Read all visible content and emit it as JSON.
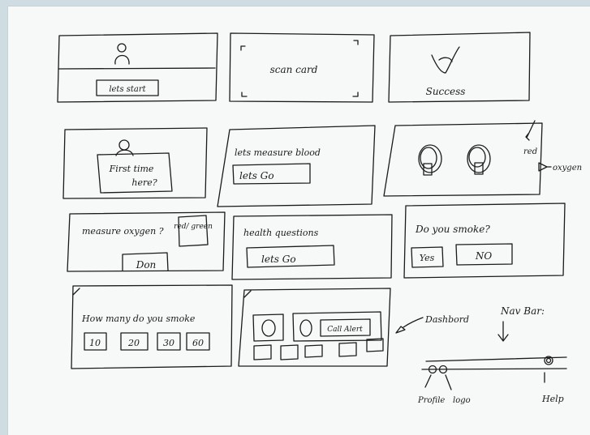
{
  "screens": {
    "s1": {
      "button": "lets start"
    },
    "s2": {
      "label": "scan card"
    },
    "s3": {
      "label": "Success"
    },
    "s4": {
      "line1": "First time",
      "line2": "here?"
    },
    "s5": {
      "title": "lets measure blood",
      "button": "lets Go"
    },
    "s6": {
      "side1": "red",
      "side2": "oxygen"
    },
    "s7": {
      "title": "measure oxygen ?",
      "chip": "red/ green",
      "button": "Don"
    },
    "s8": {
      "title": "health questions",
      "button": "lets Go"
    },
    "s9": {
      "title": "Do you smoke?",
      "yes": "Yes",
      "no": "NO"
    },
    "s10": {
      "title": "How many do you smoke",
      "options": [
        "10",
        "20",
        "30",
        "60"
      ]
    },
    "s11": {
      "button": "Call Alert"
    }
  },
  "annotations": {
    "dashboard": "Dashbord",
    "navbar": "Nav Bar:",
    "profile": "Profile",
    "logo": "logo",
    "help": "Help"
  }
}
